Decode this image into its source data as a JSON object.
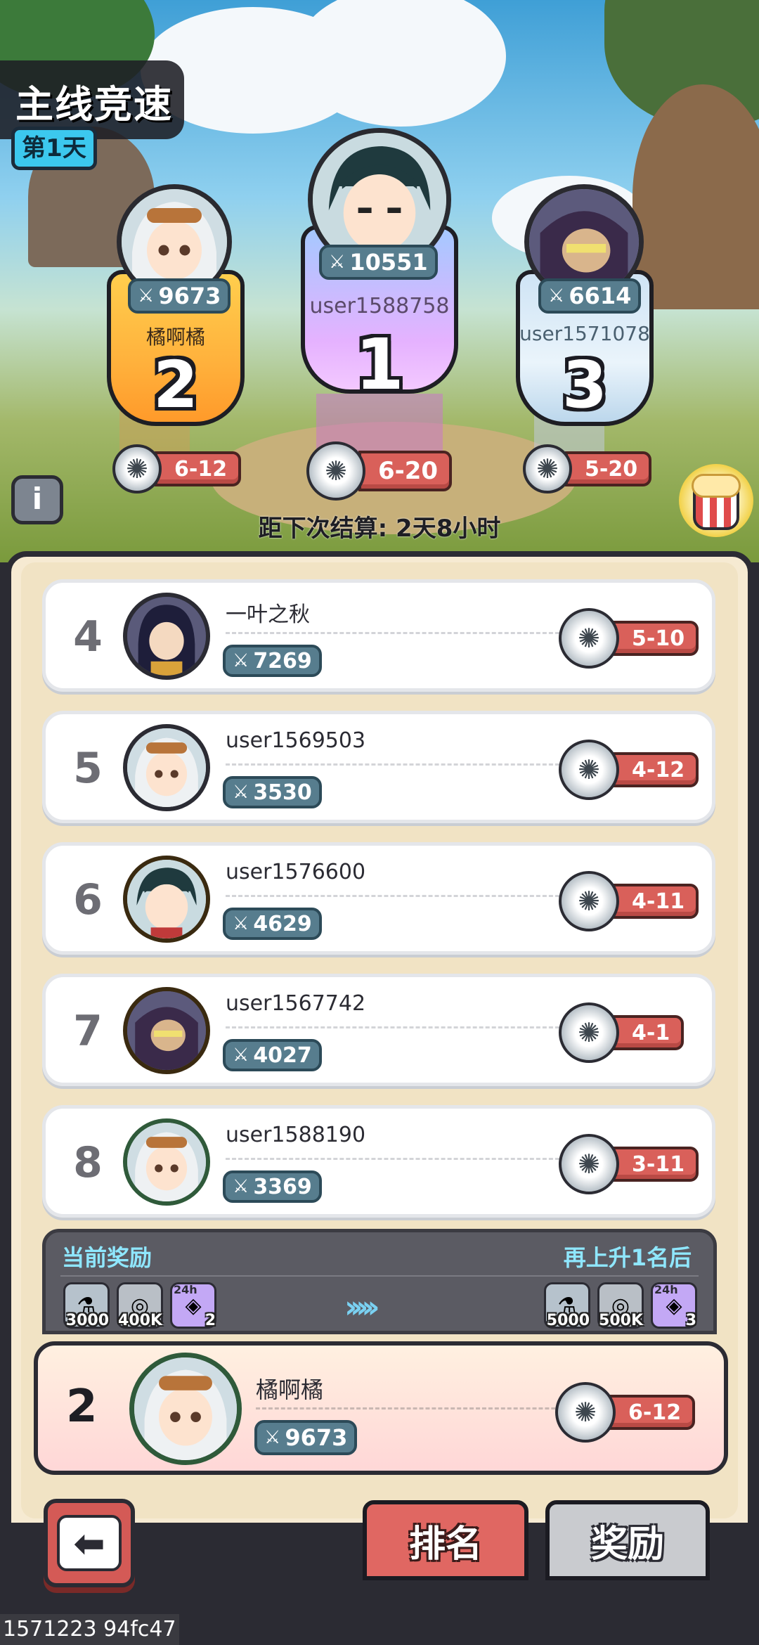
{
  "header": {
    "title": "主线竞速",
    "day": "第1天"
  },
  "podium": [
    {
      "rank": "1",
      "name": "user1588758",
      "power": "10551",
      "tier": "6-20",
      "avatar": "dark-haired-swordsman"
    },
    {
      "rank": "2",
      "name": "橘啊橘",
      "power": "9673",
      "tier": "6-12",
      "avatar": "silver-haired-girl"
    },
    {
      "rank": "3",
      "name": "user1571078",
      "power": "6614",
      "tier": "5-20",
      "avatar": "bearded-warrior"
    }
  ],
  "settle_text": "距下次结算: 2天8小时",
  "list": [
    {
      "rank": "4",
      "name": "一叶之秋",
      "power": "7269",
      "tier": "5-10",
      "avatar": "dark-haired-mage"
    },
    {
      "rank": "5",
      "name": "user1569503",
      "power": "3530",
      "tier": "4-12",
      "avatar": "silver-haired-girl"
    },
    {
      "rank": "6",
      "name": "user1576600",
      "power": "4629",
      "tier": "4-11",
      "avatar": "dark-haired-swordsman"
    },
    {
      "rank": "7",
      "name": "user1567742",
      "power": "4027",
      "tier": "4-1",
      "avatar": "bearded-warrior"
    },
    {
      "rank": "8",
      "name": "user1588190",
      "power": "3369",
      "tier": "3-11",
      "avatar": "silver-haired-girl"
    }
  ],
  "rewards": {
    "current_label": "当前奖励",
    "next_label": "再上升1名后",
    "current": [
      {
        "icon": "potion-icon",
        "count": "3000"
      },
      {
        "icon": "coin-icon",
        "count": "400K"
      },
      {
        "icon": "ticket-24h-icon",
        "count": "2"
      }
    ],
    "next": [
      {
        "icon": "potion-icon",
        "count": "5000"
      },
      {
        "icon": "coin-icon",
        "count": "500K"
      },
      {
        "icon": "ticket-24h-icon",
        "count": "3"
      }
    ],
    "ticket_tag": "24h"
  },
  "me": {
    "rank": "2",
    "name": "橘啊橘",
    "power": "9673",
    "tier": "6-12",
    "avatar": "silver-haired-girl"
  },
  "tabs": {
    "rank": "排名",
    "reward": "奖励"
  },
  "footer_id": "1571223 94fc47",
  "colors": {
    "tier_red": "#d9605a",
    "power_pill": "#577d8e",
    "panel": "#f6ead2",
    "accent_cyan": "#8fe7ff"
  }
}
